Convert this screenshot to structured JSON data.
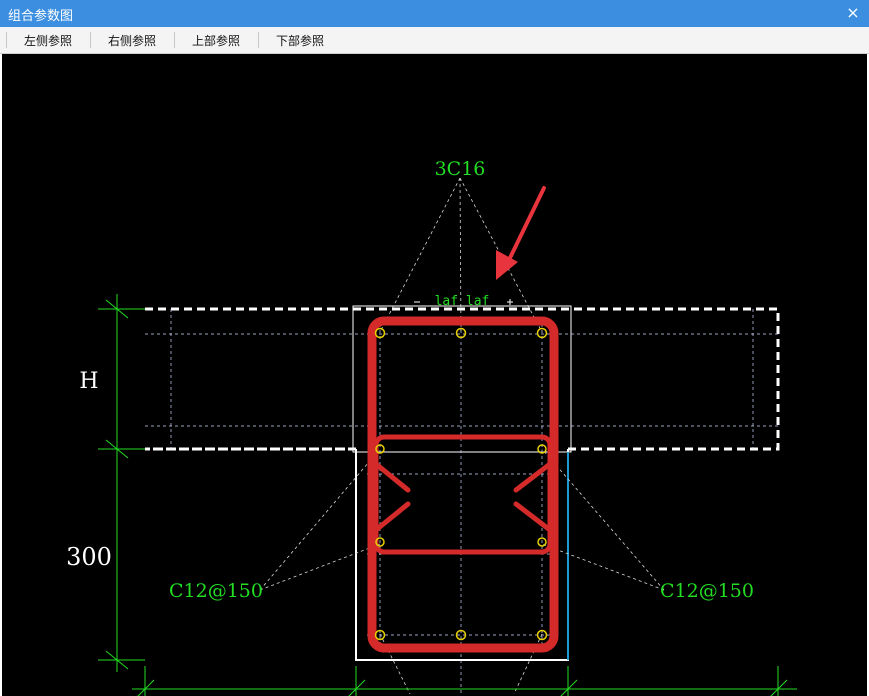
{
  "window": {
    "title": "组合参数图",
    "close_symbol": "×"
  },
  "toolbar": {
    "items": [
      "左侧参照",
      "右侧参照",
      "上部参照",
      "下部参照"
    ]
  },
  "drawing": {
    "top_bar_label": "3C16",
    "anchor_label": "laf laf",
    "left_stirrup_label": "C12@150",
    "right_stirrup_label": "C12@150",
    "dim_h_label": "H",
    "dim_300_label": "300",
    "colors": {
      "background": "#000000",
      "rebar": "#d42a2a",
      "dimension": "#22dd22",
      "outline": "#ffffff",
      "annotation_arrow": "#e8343c",
      "bar_marker": "#e8d000",
      "edge_blue": "#1e9bd7"
    }
  }
}
